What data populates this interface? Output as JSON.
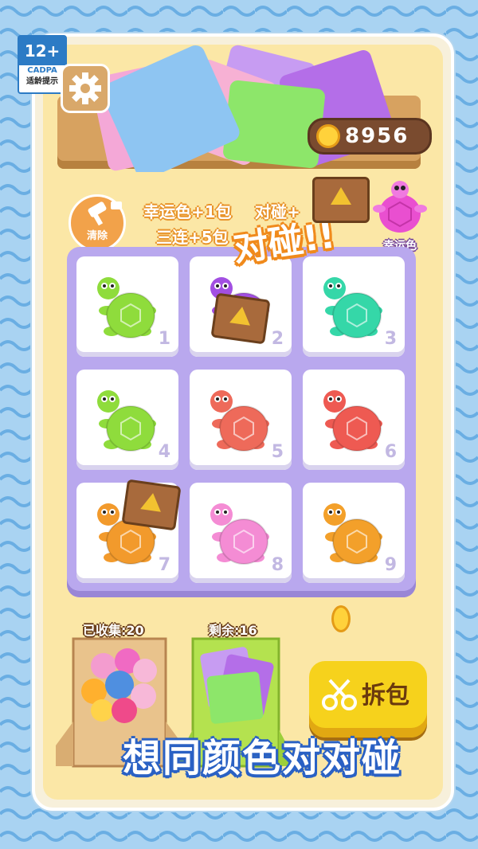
{
  "age_badge": {
    "rating": "12+",
    "org": "CADPA",
    "caption": "适龄提示"
  },
  "coins": {
    "count": "8956"
  },
  "tools": {
    "clear_label": "清除"
  },
  "bonus_info": {
    "line1": "幸运色+1包",
    "line1_b": "对碰+",
    "line2": "三连+5包"
  },
  "lucky": {
    "label": "幸运色",
    "color": "#e94fd0"
  },
  "popup": {
    "text": "对碰!!"
  },
  "grid": {
    "cells": [
      {
        "num": "1",
        "turtle": "#8fdc3c"
      },
      {
        "num": "2",
        "turtle": "#a24fe2"
      },
      {
        "num": "3",
        "turtle": "#35d7a8"
      },
      {
        "num": "4",
        "turtle": "#8fdc3c"
      },
      {
        "num": "5",
        "turtle": "#ee6a5a"
      },
      {
        "num": "6",
        "turtle": "#ee5a52"
      },
      {
        "num": "7",
        "turtle": "#f29a2c"
      },
      {
        "num": "8",
        "turtle": "#f48cd4"
      },
      {
        "num": "9",
        "turtle": "#f3a02a"
      }
    ]
  },
  "collected": {
    "label": "已收集:20"
  },
  "remaining": {
    "label": "剩余:16"
  },
  "unpack_button": {
    "label": "拆包"
  },
  "headline": {
    "text": "想同颜色对对碰"
  }
}
